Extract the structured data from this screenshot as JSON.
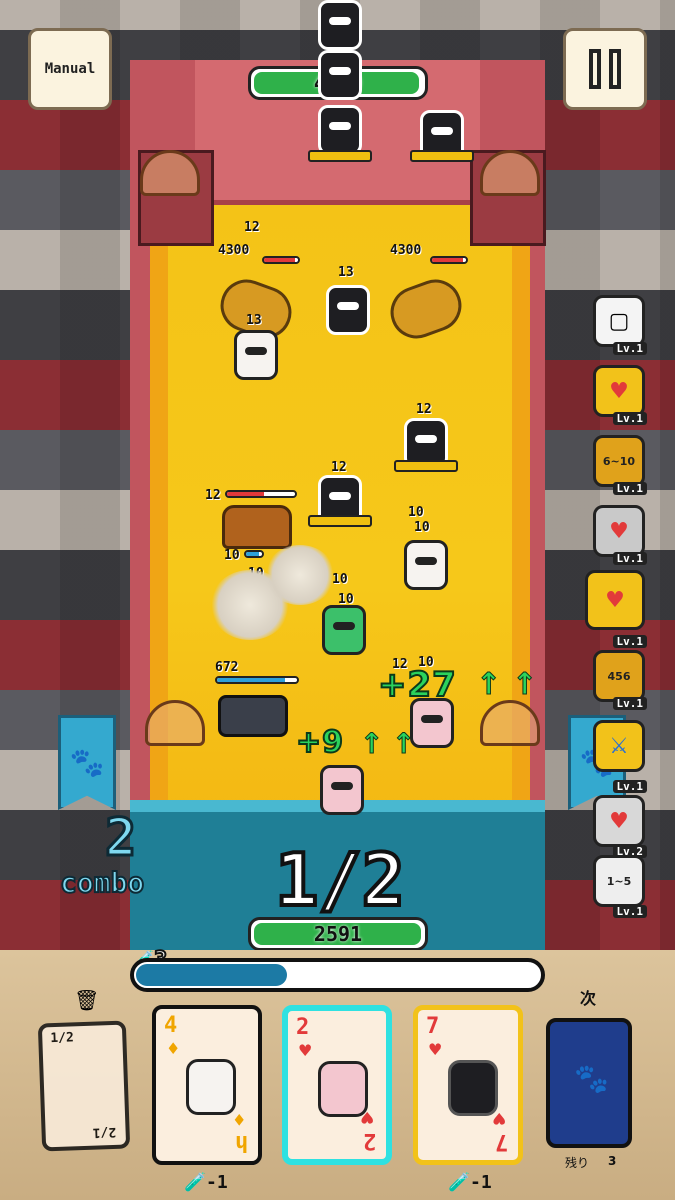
{
  "top": {
    "manual_label": "Manual",
    "boss_hp_text": "4300",
    "boss_hp_fraction": 0.95
  },
  "enemies": {
    "hp_labels": [
      "12",
      "4300",
      "4300",
      "13",
      "13",
      "12",
      "12",
      "12",
      "10",
      "10",
      "672",
      "10",
      "10",
      "10",
      "10",
      "12",
      "10"
    ]
  },
  "popups": {
    "big_heal": "+27",
    "small_heal": "+9"
  },
  "combo": {
    "count": "2",
    "label": "combo"
  },
  "turn": {
    "text": "1/2",
    "player_hp_text": "2591",
    "player_hp_fraction": 0.96
  },
  "levels": [
    {
      "tag": "Lv.1"
    },
    {
      "tag": "Lv.1"
    },
    {
      "tag": "Lv.1",
      "value": "6~10"
    },
    {
      "tag": "Lv.1"
    },
    {
      "tag": "Lv.1"
    },
    {
      "tag": "Lv.1",
      "value": "456"
    },
    {
      "tag": "Lv.1"
    },
    {
      "tag": "Lv.2"
    },
    {
      "tag": "Lv.1",
      "value": "1~5"
    }
  ],
  "deck": {
    "energy": "3",
    "energy_fraction": 0.37,
    "discard_card_rank": "1/2",
    "discard_card_rank_b": "2/1",
    "next_label": "次",
    "remaining_label": "残り",
    "remaining_count": "3",
    "cards": [
      {
        "rank": "4",
        "suit": "♦",
        "suit_color": "#f0a500",
        "rank_b": "h",
        "border": "#111111"
      },
      {
        "rank": "2",
        "suit": "♥",
        "suit_color": "#e23a3a",
        "rank_b": "2",
        "border": "#2fe1e1"
      },
      {
        "rank": "7",
        "suit": "♥",
        "suit_color": "#e23a3a",
        "rank_b": "7",
        "border": "#f2c21a"
      }
    ],
    "costs": [
      "-1",
      "-1"
    ]
  },
  "colors": {
    "accent_green": "#2bd35c",
    "hp_green": "#2fb14a",
    "combo_blue": "#7fd9f0"
  }
}
